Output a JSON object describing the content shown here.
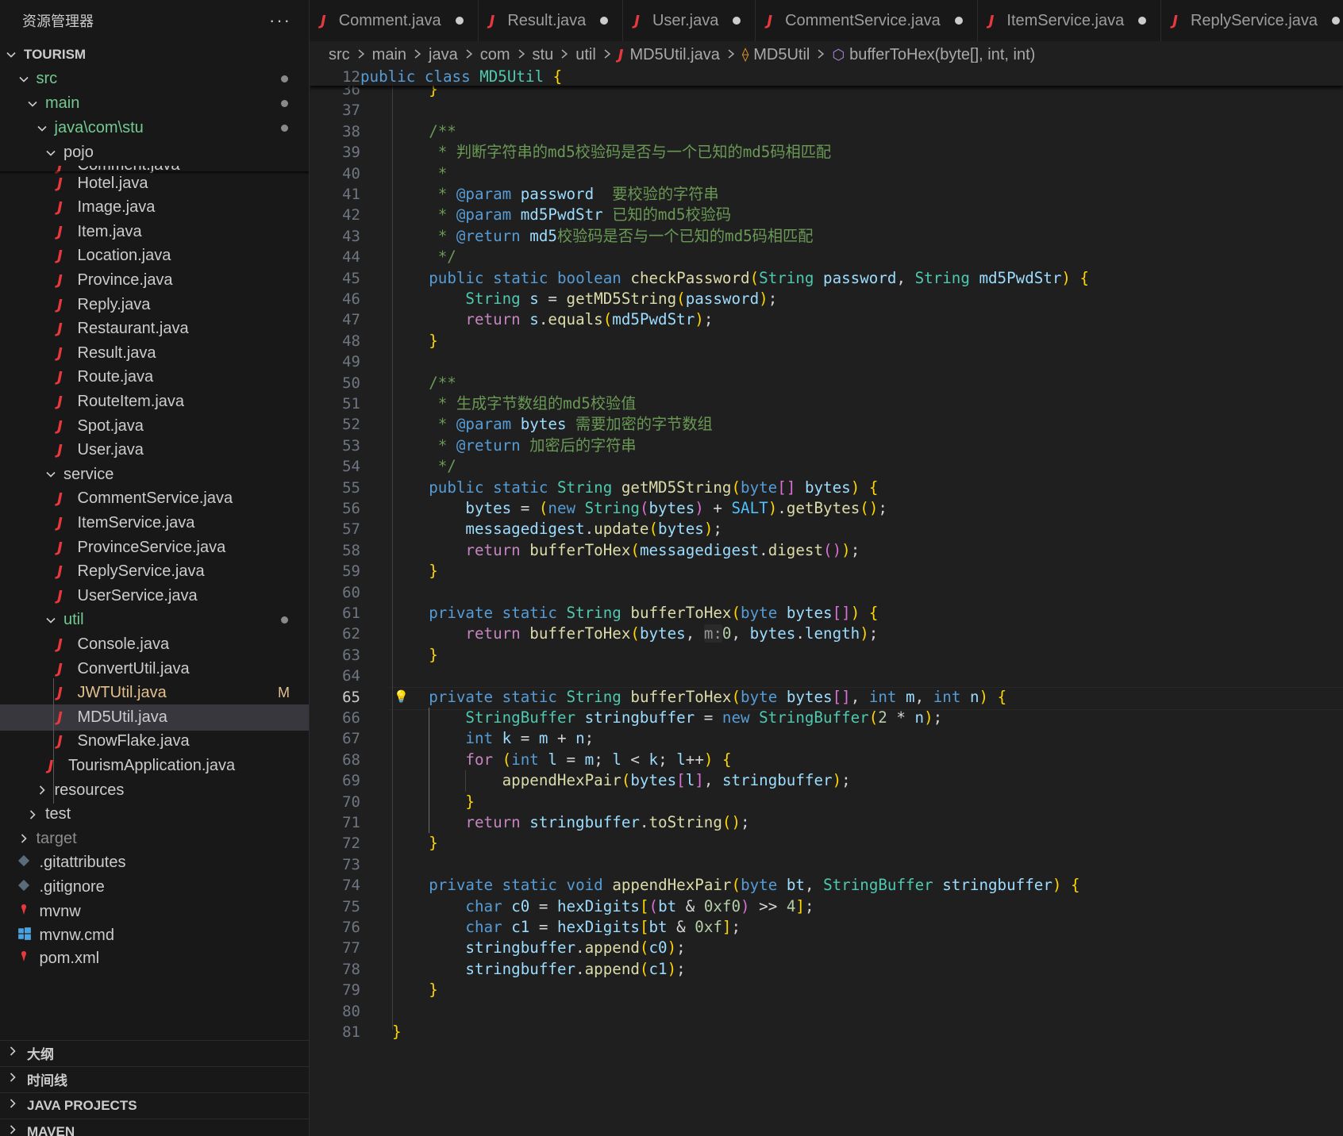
{
  "explorer": {
    "title": "资源管理器",
    "more_icon": "···",
    "items": [
      {
        "label": "TOURISM",
        "kind": "root",
        "chevron": "down",
        "indent": 0
      },
      {
        "label": "src",
        "kind": "folder",
        "chevron": "down",
        "indent": 1,
        "dot": true,
        "color": "green"
      },
      {
        "label": "main",
        "kind": "folder",
        "chevron": "down",
        "indent": 2,
        "dot": true,
        "color": "green"
      },
      {
        "label": "java\\com\\stu",
        "kind": "folder",
        "chevron": "down",
        "indent": 3,
        "dot": true,
        "color": "green"
      },
      {
        "label": "pojo",
        "kind": "folder",
        "chevron": "down",
        "indent": 4
      },
      {
        "label": "Comment.java",
        "kind": "java",
        "indent": 5,
        "partial": true
      },
      {
        "label": "Hotel.java",
        "kind": "java",
        "indent": 5
      },
      {
        "label": "Image.java",
        "kind": "java",
        "indent": 5
      },
      {
        "label": "Item.java",
        "kind": "java",
        "indent": 5
      },
      {
        "label": "Location.java",
        "kind": "java",
        "indent": 5
      },
      {
        "label": "Province.java",
        "kind": "java",
        "indent": 5
      },
      {
        "label": "Reply.java",
        "kind": "java",
        "indent": 5
      },
      {
        "label": "Restaurant.java",
        "kind": "java",
        "indent": 5
      },
      {
        "label": "Result.java",
        "kind": "java",
        "indent": 5
      },
      {
        "label": "Route.java",
        "kind": "java",
        "indent": 5
      },
      {
        "label": "RouteItem.java",
        "kind": "java",
        "indent": 5
      },
      {
        "label": "Spot.java",
        "kind": "java",
        "indent": 5
      },
      {
        "label": "User.java",
        "kind": "java",
        "indent": 5
      },
      {
        "label": "service",
        "kind": "folder",
        "chevron": "down",
        "indent": 4
      },
      {
        "label": "CommentService.java",
        "kind": "java",
        "indent": 5
      },
      {
        "label": "ItemService.java",
        "kind": "java",
        "indent": 5
      },
      {
        "label": "ProvinceService.java",
        "kind": "java",
        "indent": 5
      },
      {
        "label": "ReplyService.java",
        "kind": "java",
        "indent": 5
      },
      {
        "label": "UserService.java",
        "kind": "java",
        "indent": 5
      },
      {
        "label": "util",
        "kind": "folder",
        "chevron": "down",
        "indent": 4,
        "dot": true,
        "color": "green"
      },
      {
        "label": "Console.java",
        "kind": "java",
        "indent": 5
      },
      {
        "label": "ConvertUtil.java",
        "kind": "java",
        "indent": 5
      },
      {
        "label": "JWTUtil.java",
        "kind": "java",
        "indent": 5,
        "badge": "M",
        "color": "mod"
      },
      {
        "label": "MD5Util.java",
        "kind": "java",
        "indent": 5,
        "selected": true
      },
      {
        "label": "SnowFlake.java",
        "kind": "java",
        "indent": 5
      },
      {
        "label": "TourismApplication.java",
        "kind": "java",
        "indent": 4
      },
      {
        "label": "resources",
        "kind": "folder",
        "chevron": "right",
        "indent": 3
      },
      {
        "label": "test",
        "kind": "folder",
        "chevron": "right",
        "indent": 2
      },
      {
        "label": "target",
        "kind": "folder",
        "chevron": "right",
        "indent": 1,
        "color": "dim"
      },
      {
        "label": ".gitattributes",
        "kind": "git",
        "indent": 1
      },
      {
        "label": ".gitignore",
        "kind": "git",
        "indent": 1
      },
      {
        "label": "mvnw",
        "kind": "mvn",
        "indent": 1
      },
      {
        "label": "mvnw.cmd",
        "kind": "win",
        "indent": 1
      },
      {
        "label": "pom.xml",
        "kind": "mvn",
        "indent": 1,
        "partial": true
      }
    ],
    "panels": [
      "大纲",
      "时间线",
      "JAVA PROJECTS",
      "MAVEN"
    ]
  },
  "tabs": [
    {
      "label": "Comment.java"
    },
    {
      "label": "Result.java"
    },
    {
      "label": "User.java"
    },
    {
      "label": "CommentService.java"
    },
    {
      "label": "ItemService.java"
    },
    {
      "label": "ReplyService.java"
    }
  ],
  "breadcrumb": [
    "src",
    "main",
    "java",
    "com",
    "stu",
    "util",
    "MD5Util.java",
    "MD5Util",
    "bufferToHex(byte[], int, int)"
  ],
  "editor": {
    "sticky_line": {
      "num": "12",
      "text": "public class MD5Util {"
    },
    "current_line": "65",
    "lines": [
      {
        "num": "36",
        "text": "    }"
      },
      {
        "num": "37",
        "text": ""
      },
      {
        "num": "38",
        "text": "    /**"
      },
      {
        "num": "39",
        "text": "     * 判断字符串的md5校验码是否与一个已知的md5码相匹配"
      },
      {
        "num": "40",
        "text": "     *"
      },
      {
        "num": "41",
        "text": "     * @param password  要校验的字符串"
      },
      {
        "num": "42",
        "text": "     * @param md5PwdStr 已知的md5校验码"
      },
      {
        "num": "43",
        "text": "     * @return md5校验码是否与一个已知的md5码相匹配"
      },
      {
        "num": "44",
        "text": "     */"
      },
      {
        "num": "45",
        "text": "    public static boolean checkPassword(String password, String md5PwdStr) {"
      },
      {
        "num": "46",
        "text": "        String s = getMD5String(password);"
      },
      {
        "num": "47",
        "text": "        return s.equals(md5PwdStr);"
      },
      {
        "num": "48",
        "text": "    }"
      },
      {
        "num": "49",
        "text": ""
      },
      {
        "num": "50",
        "text": "    /**"
      },
      {
        "num": "51",
        "text": "     * 生成字节数组的md5校验值"
      },
      {
        "num": "52",
        "text": "     * @param bytes 需要加密的字节数组"
      },
      {
        "num": "53",
        "text": "     * @return 加密后的字符串"
      },
      {
        "num": "54",
        "text": "     */"
      },
      {
        "num": "55",
        "text": "    public static String getMD5String(byte[] bytes) {"
      },
      {
        "num": "56",
        "text": "        bytes = (new String(bytes) + SALT).getBytes();"
      },
      {
        "num": "57",
        "text": "        messagedigest.update(bytes);"
      },
      {
        "num": "58",
        "text": "        return bufferToHex(messagedigest.digest());"
      },
      {
        "num": "59",
        "text": "    }"
      },
      {
        "num": "60",
        "text": ""
      },
      {
        "num": "61",
        "text": "    private static String bufferToHex(byte bytes[]) {"
      },
      {
        "num": "62",
        "text": "        return bufferToHex(bytes, m:0, bytes.length);"
      },
      {
        "num": "63",
        "text": "    }"
      },
      {
        "num": "64",
        "text": ""
      },
      {
        "num": "65",
        "text": "    private static String bufferToHex(byte bytes[], int m, int n) {"
      },
      {
        "num": "66",
        "text": "        StringBuffer stringbuffer = new StringBuffer(2 * n);"
      },
      {
        "num": "67",
        "text": "        int k = m + n;"
      },
      {
        "num": "68",
        "text": "        for (int l = m; l < k; l++) {"
      },
      {
        "num": "69",
        "text": "            appendHexPair(bytes[l], stringbuffer);"
      },
      {
        "num": "70",
        "text": "        }"
      },
      {
        "num": "71",
        "text": "        return stringbuffer.toString();"
      },
      {
        "num": "72",
        "text": "    }"
      },
      {
        "num": "73",
        "text": ""
      },
      {
        "num": "74",
        "text": "    private static void appendHexPair(byte bt, StringBuffer stringbuffer) {"
      },
      {
        "num": "75",
        "text": "        char c0 = hexDigits[(bt & 0xf0) >> 4];"
      },
      {
        "num": "76",
        "text": "        char c1 = hexDigits[bt & 0xf];"
      },
      {
        "num": "77",
        "text": "        stringbuffer.append(c0);"
      },
      {
        "num": "78",
        "text": "        stringbuffer.append(c1);"
      },
      {
        "num": "79",
        "text": "    }"
      },
      {
        "num": "80",
        "text": ""
      },
      {
        "num": "81",
        "text": "}"
      }
    ]
  },
  "colors": {
    "keyword": "#569cd6",
    "control": "#c586c0",
    "type": "#4ec9b0",
    "function": "#dcdcaa",
    "variable": "#9cdcfe",
    "number": "#b5cea8",
    "comment": "#6a9955",
    "constant": "#4fc1ff",
    "java_icon": "#e8383d",
    "modified": "#e2c08d",
    "untracked": "#73c991"
  }
}
